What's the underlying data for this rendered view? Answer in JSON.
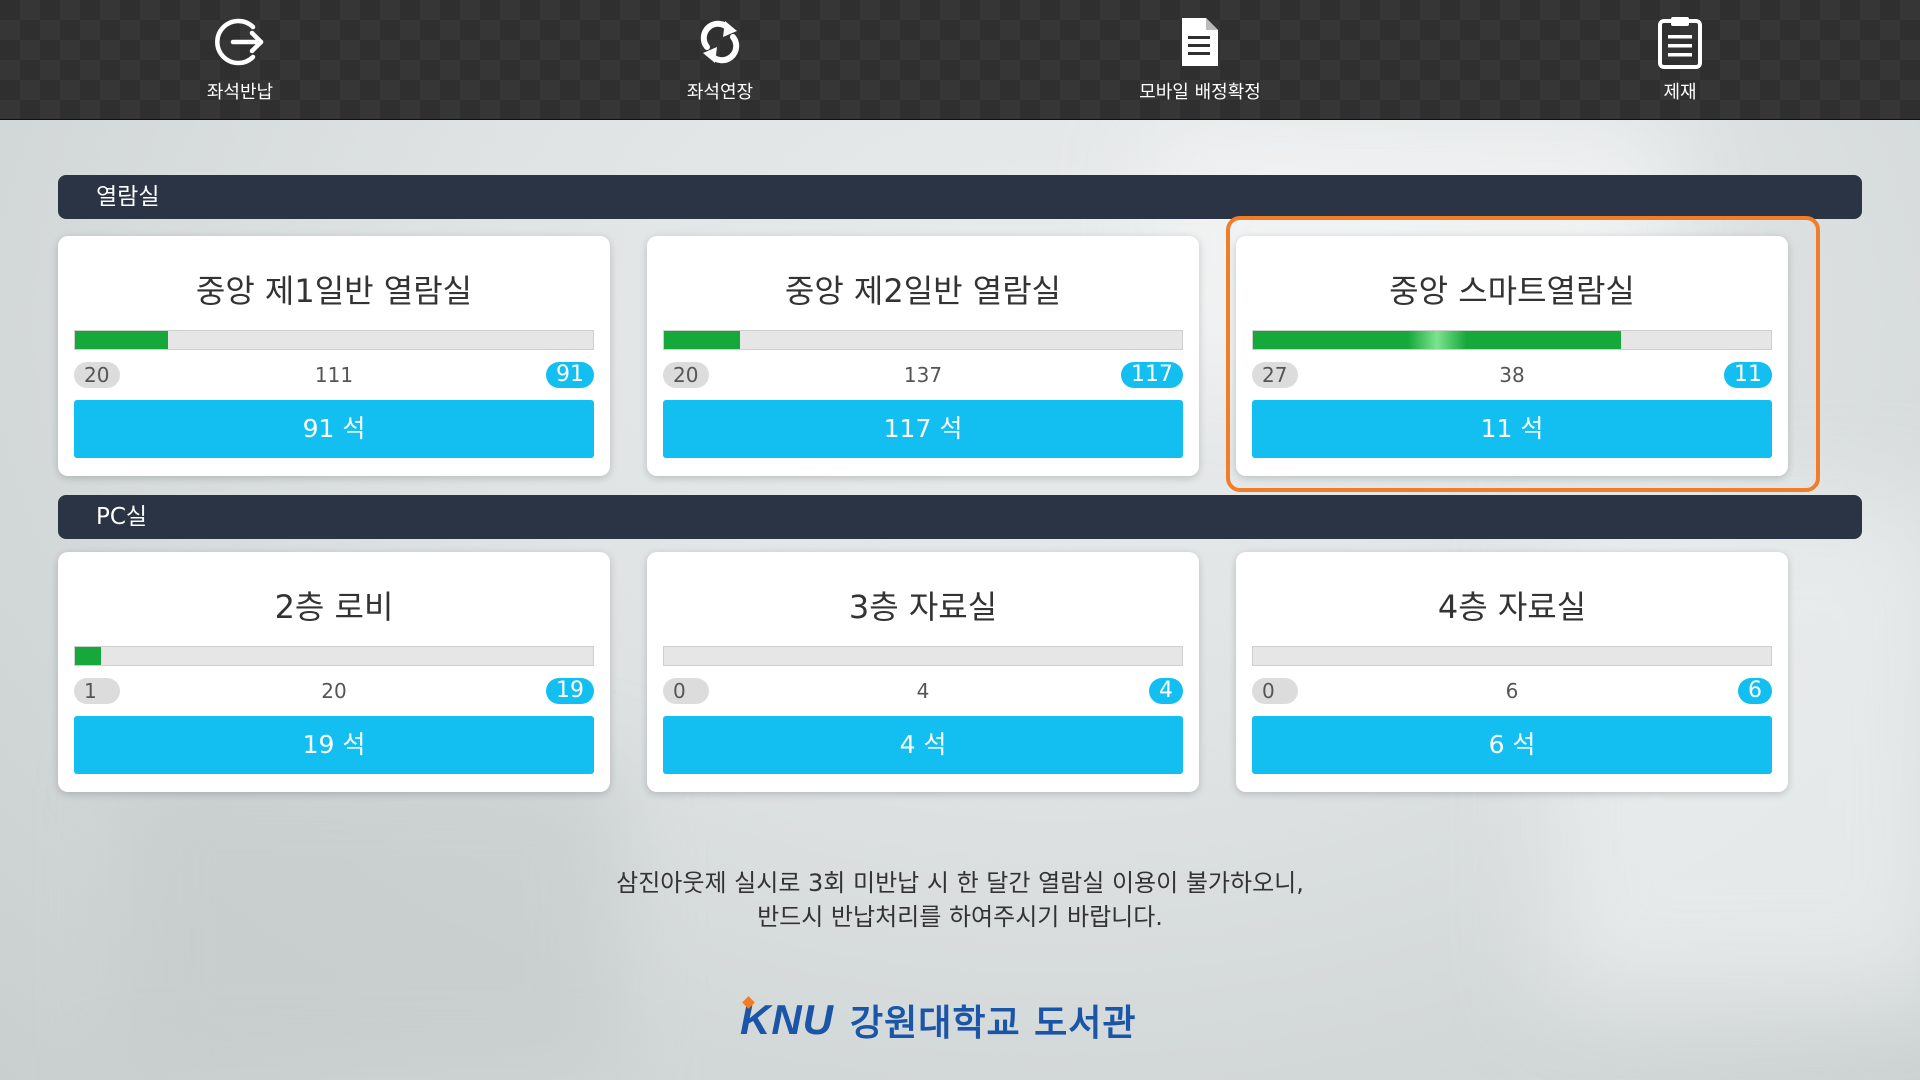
{
  "nav": {
    "items": [
      {
        "label": "좌석반납",
        "icon": "return-arrow-icon"
      },
      {
        "label": "좌석연장",
        "icon": "refresh-icon"
      },
      {
        "label": "모바일 배정확정",
        "icon": "document-icon"
      },
      {
        "label": "제재",
        "icon": "clipboard-icon"
      }
    ]
  },
  "sections": [
    {
      "title": "열람실",
      "rooms": [
        {
          "name": "중앙 제1일반 열람실",
          "used": "20",
          "total": "111",
          "available": "91",
          "button": "91 석",
          "usage_fraction": 0.18
        },
        {
          "name": "중앙 제2일반 열람실",
          "used": "20",
          "total": "137",
          "available": "117",
          "button": "117 석",
          "usage_fraction": 0.146
        },
        {
          "name": "중앙 스마트열람실",
          "used": "27",
          "total": "38",
          "available": "11",
          "button": "11 석",
          "usage_fraction": 0.71,
          "highlighted": true
        }
      ]
    },
    {
      "title": "PC실",
      "rooms": [
        {
          "name": "2층 로비",
          "used": "1",
          "total": "20",
          "available": "19",
          "button": "19 석",
          "usage_fraction": 0.05
        },
        {
          "name": "3층 자료실",
          "used": "0",
          "total": "4",
          "available": "4",
          "button": "4 석",
          "usage_fraction": 0
        },
        {
          "name": "4층 자료실",
          "used": "0",
          "total": "6",
          "available": "6",
          "button": "6 석",
          "usage_fraction": 0
        }
      ]
    }
  ],
  "notice": {
    "line1": "삼진아웃제 실시로 3회 미반납 시 한 달간 열람실 이용이 불가하오니,",
    "line2": "반드시 반납처리를 하여주시기 바랍니다."
  },
  "footer": {
    "logo_mark": "KNU",
    "logo_name": "강원대학교 도서관"
  },
  "colors": {
    "nav_bg": "#2f2f2f",
    "section_bar": "#2b3444",
    "accent_blue": "#12bff0",
    "progress_green": "#16a83a",
    "highlight_orange": "#ef7d2a",
    "brand_blue": "#1a55a8"
  }
}
